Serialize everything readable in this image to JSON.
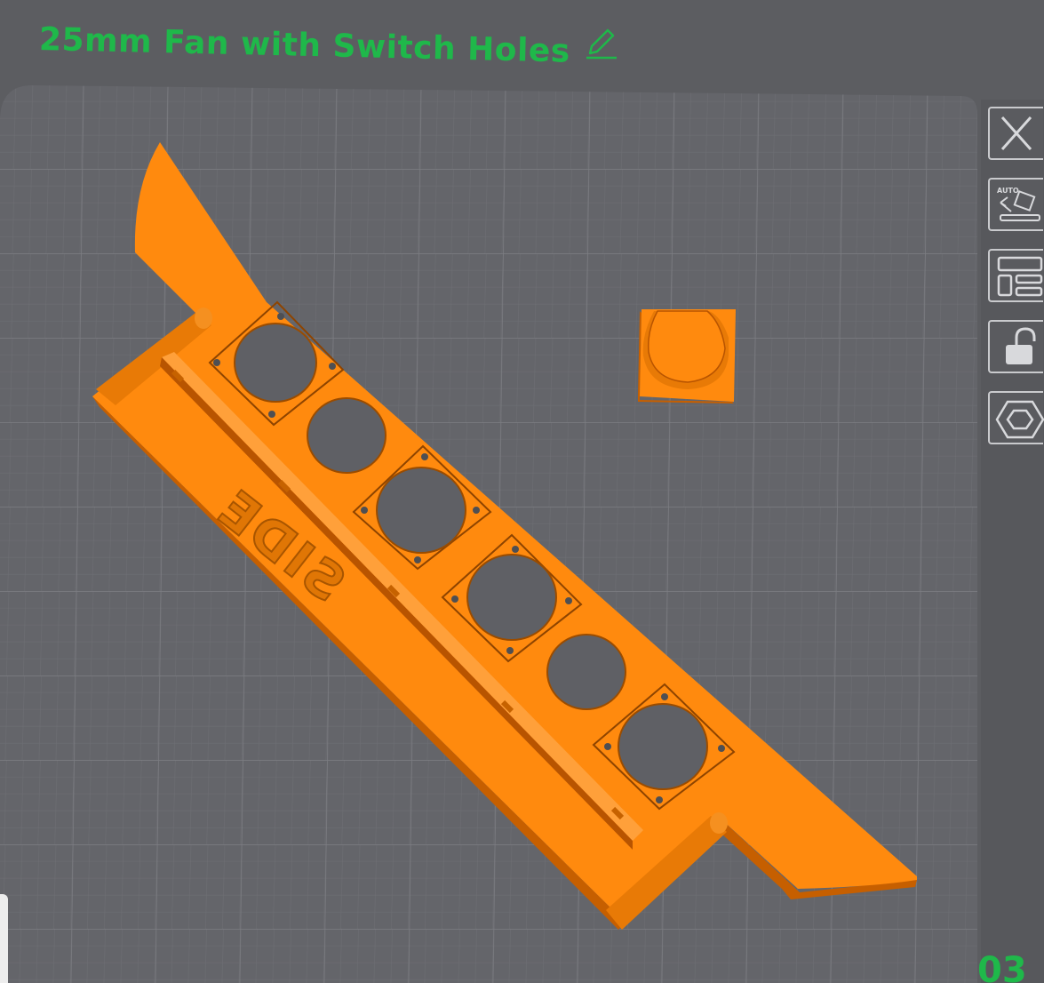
{
  "header": {
    "title": "25mm Fan with Switch Holes",
    "edit_icon": "pencil-icon"
  },
  "viewport": {
    "embossed_label": "SIDE",
    "model_color": "#ff8a0e",
    "bed_color": "#64656a",
    "grid_color": "#75767b"
  },
  "toolbar": {
    "buttons": [
      {
        "name": "close-button",
        "icon": "close-icon"
      },
      {
        "name": "auto-orient-button",
        "icon": "auto-orient-icon",
        "label": "AUTO"
      },
      {
        "name": "arrange-button",
        "icon": "layout-icon"
      },
      {
        "name": "lock-button",
        "icon": "unlock-icon"
      },
      {
        "name": "settings-button",
        "icon": "hex-nut-icon"
      }
    ]
  },
  "footer": {
    "page_number": "03"
  },
  "theme": {
    "accent": "#1fb84a",
    "background": "#5c5d61"
  }
}
